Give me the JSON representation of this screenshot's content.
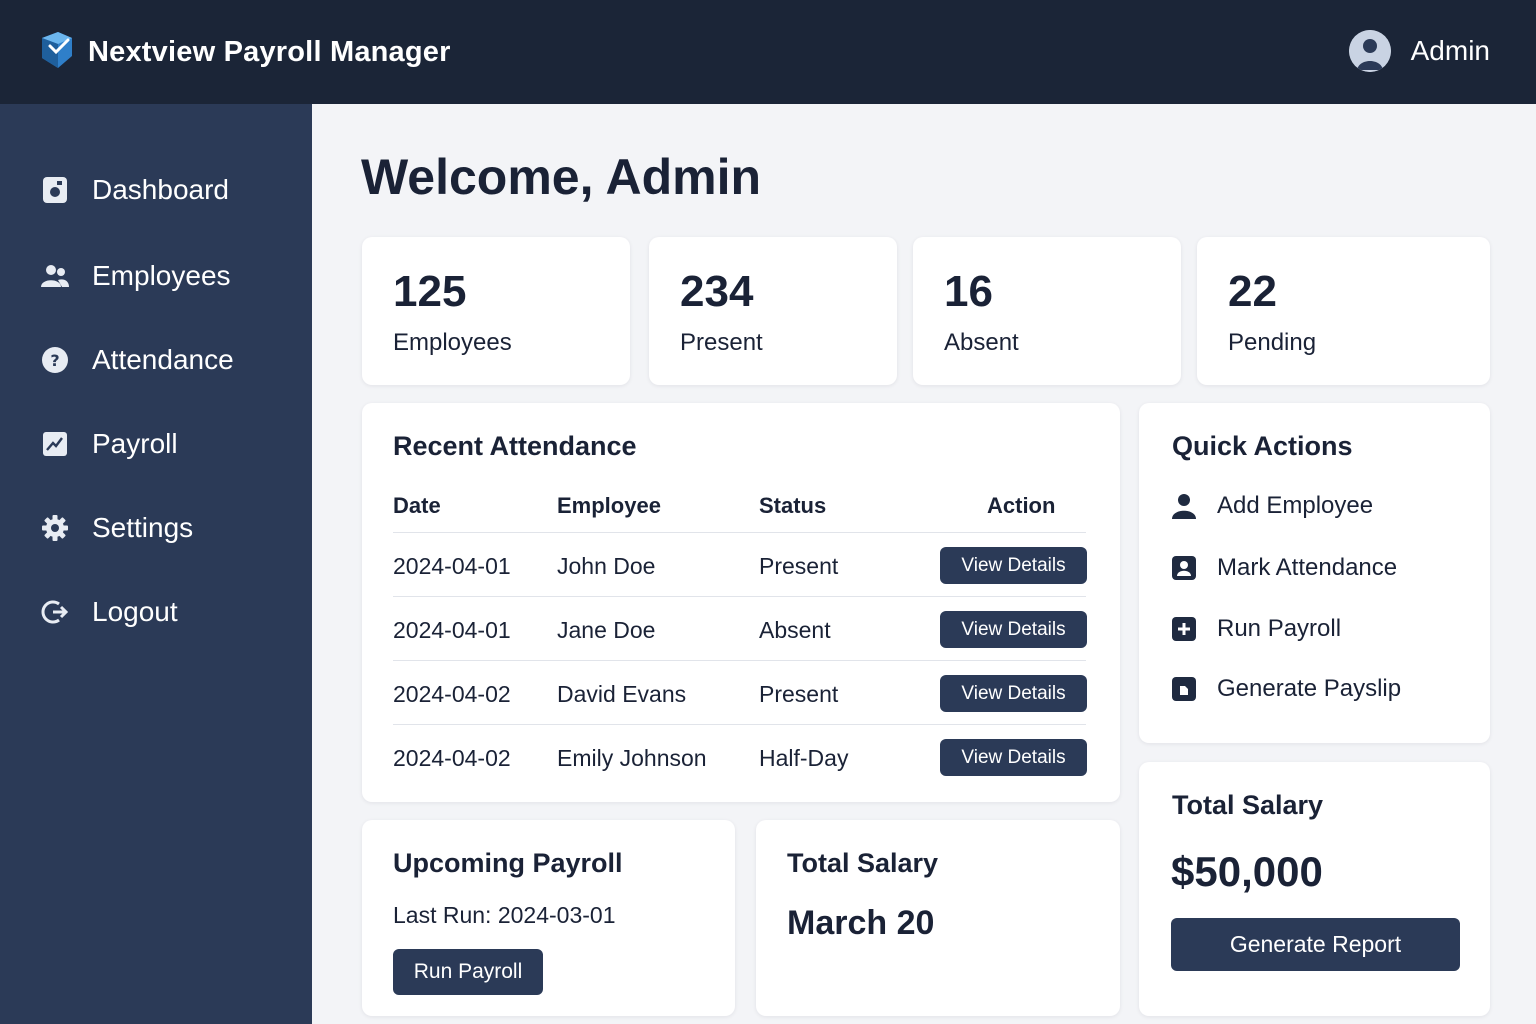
{
  "header": {
    "app_title": "Nextview Payroll Manager",
    "user_name": "Admin"
  },
  "sidebar": {
    "items": [
      {
        "label": "Dashboard",
        "icon": "dashboard-icon"
      },
      {
        "label": "Employees",
        "icon": "users-icon"
      },
      {
        "label": "Attendance",
        "icon": "question-icon"
      },
      {
        "label": "Payroll",
        "icon": "chart-icon"
      },
      {
        "label": "Settings",
        "icon": "gear-icon"
      },
      {
        "label": "Logout",
        "icon": "logout-icon"
      }
    ]
  },
  "main": {
    "welcome": "Welcome, Admin",
    "stats": [
      {
        "value": "125",
        "label": "Employees"
      },
      {
        "value": "234",
        "label": "Present"
      },
      {
        "value": "16",
        "label": "Absent"
      },
      {
        "value": "22",
        "label": "Pending"
      }
    ],
    "attendance": {
      "title": "Recent Attendance",
      "columns": [
        "Date",
        "Employee",
        "Status",
        "Action"
      ],
      "rows": [
        {
          "date": "2024-04-01",
          "employee": "John Doe",
          "status": "Present",
          "action": "View Details"
        },
        {
          "date": "2024-04-01",
          "employee": "Jane Doe",
          "status": "Absent",
          "action": "View Details"
        },
        {
          "date": "2024-04-02",
          "employee": "David Evans",
          "status": "Present",
          "action": "View Details"
        },
        {
          "date": "2024-04-02",
          "employee": "Emily Johnson",
          "status": "Half-Day",
          "action": "View Details"
        }
      ]
    },
    "quick_actions": {
      "title": "Quick Actions",
      "items": [
        {
          "label": "Add Employee",
          "icon": "user-icon"
        },
        {
          "label": "Mark Attendance",
          "icon": "user-badge-icon"
        },
        {
          "label": "Run Payroll",
          "icon": "plus-square-icon"
        },
        {
          "label": "Generate Payslip",
          "icon": "document-icon"
        }
      ]
    },
    "upcoming_payroll": {
      "title": "Upcoming Payroll",
      "last_run": "Last Run: 2024-03-01",
      "button": "Run Payroll"
    },
    "total_salary_month": {
      "title": "Total Salary",
      "month": "March 20"
    },
    "total_salary": {
      "title": "Total Salary",
      "amount": "$50,000",
      "button": "Generate Report"
    }
  },
  "colors": {
    "topbar": "#1b2537",
    "sidebar": "#2b3a57",
    "button": "#2b3a57",
    "background": "#f3f4f7",
    "brand_icon": "#3a8fd6"
  }
}
